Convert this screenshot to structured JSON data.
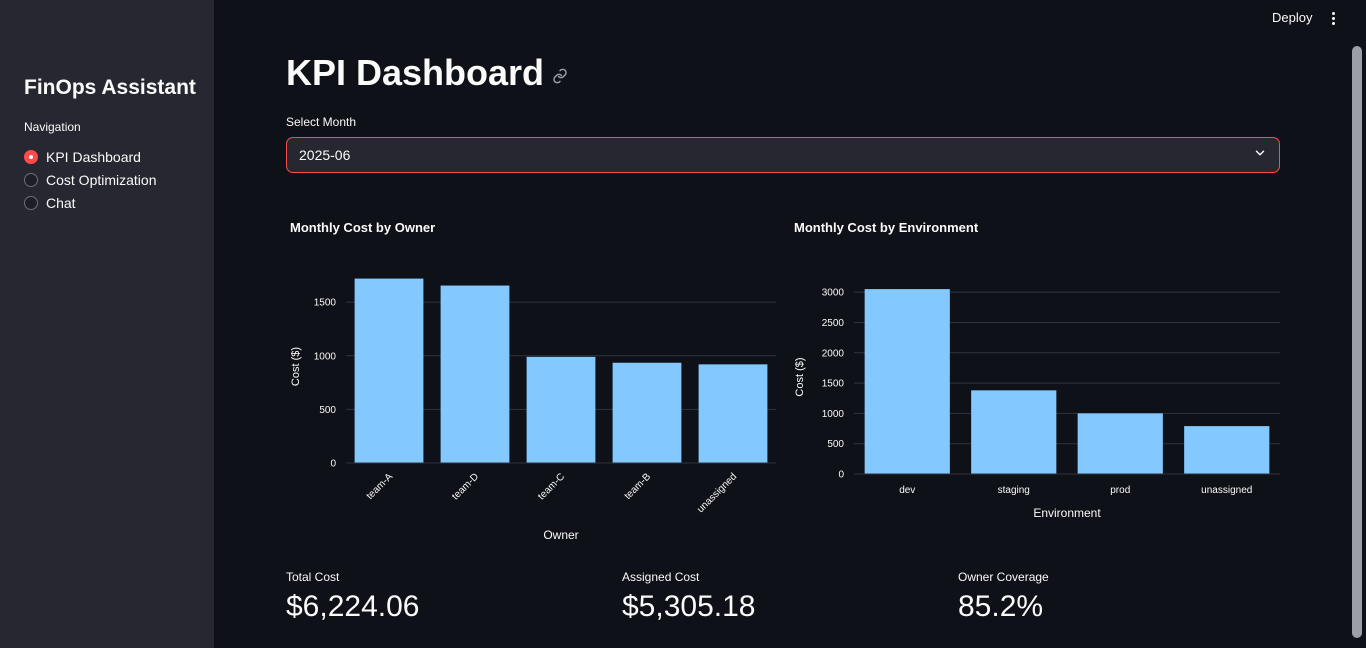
{
  "header": {
    "deploy_label": "Deploy",
    "menu_icon": "more-vertical-icon"
  },
  "sidebar": {
    "title": "FinOps Assistant",
    "nav_label": "Navigation",
    "items": [
      {
        "label": "KPI Dashboard",
        "selected": true
      },
      {
        "label": "Cost Optimization",
        "selected": false
      },
      {
        "label": "Chat",
        "selected": false
      }
    ]
  },
  "main": {
    "title": "KPI Dashboard",
    "select_label": "Select Month",
    "select_value": "2025-06"
  },
  "charts": {
    "owner_title": "Monthly Cost by Owner",
    "env_title": "Monthly Cost by Environment"
  },
  "chart_data": [
    {
      "type": "bar",
      "title": "Monthly Cost by Owner",
      "xlabel": "Owner",
      "ylabel": "Cost ($)",
      "categories": [
        "team-A",
        "team-D",
        "team-C",
        "team-B",
        "unassigned"
      ],
      "values": [
        1720,
        1655,
        990,
        935,
        920
      ],
      "ylim": [
        0,
        1800
      ],
      "yticks": [
        0,
        500,
        1000,
        1500
      ],
      "grid": true,
      "color": "#83c9ff"
    },
    {
      "type": "bar",
      "title": "Monthly Cost by Environment",
      "xlabel": "Environment",
      "ylabel": "Cost ($)",
      "categories": [
        "dev",
        "staging",
        "prod",
        "unassigned"
      ],
      "values": [
        3050,
        1380,
        1000,
        790
      ],
      "ylim": [
        0,
        3200
      ],
      "yticks": [
        0,
        500,
        1000,
        1500,
        2000,
        2500,
        3000
      ],
      "grid": true,
      "color": "#83c9ff"
    }
  ],
  "metrics": [
    {
      "label": "Total Cost",
      "value": "$6,224.06"
    },
    {
      "label": "Assigned Cost",
      "value": "$5,305.18"
    },
    {
      "label": "Owner Coverage",
      "value": "85.2%"
    }
  ]
}
